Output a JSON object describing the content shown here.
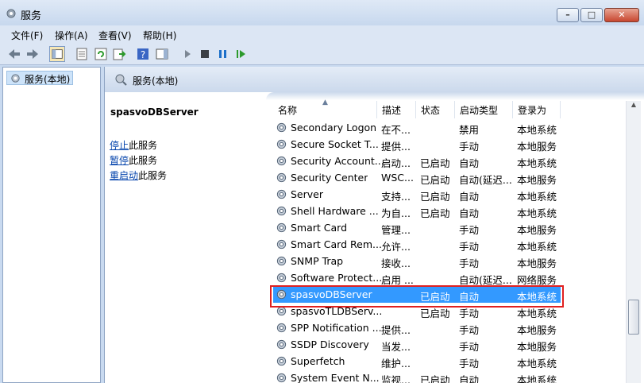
{
  "window": {
    "title": "服务"
  },
  "menu": [
    "文件(F)",
    "操作(A)",
    "查看(V)",
    "帮助(H)"
  ],
  "tree": {
    "root_label": "服务(本地)"
  },
  "content": {
    "header_label": "服务(本地)",
    "service_title": "spasvoDBServer",
    "actions": [
      {
        "link": "停止",
        "suffix": "此服务"
      },
      {
        "link": "暂停",
        "suffix": "此服务"
      },
      {
        "link": "重启动",
        "suffix": "此服务"
      }
    ]
  },
  "columns": [
    "名称",
    "描述",
    "状态",
    "启动类型",
    "登录为"
  ],
  "services": [
    {
      "name": "Secondary Logon",
      "desc": "在不...",
      "status": "",
      "startup": "禁用",
      "logon": "本地系统"
    },
    {
      "name": "Secure Socket T...",
      "desc": "提供...",
      "status": "",
      "startup": "手动",
      "logon": "本地服务"
    },
    {
      "name": "Security Account...",
      "desc": "启动...",
      "status": "已启动",
      "startup": "自动",
      "logon": "本地系统"
    },
    {
      "name": "Security Center",
      "desc": "WSC...",
      "status": "已启动",
      "startup": "自动(延迟...",
      "logon": "本地服务"
    },
    {
      "name": "Server",
      "desc": "支持...",
      "status": "已启动",
      "startup": "自动",
      "logon": "本地系统"
    },
    {
      "name": "Shell Hardware ...",
      "desc": "为自...",
      "status": "已启动",
      "startup": "自动",
      "logon": "本地系统"
    },
    {
      "name": "Smart Card",
      "desc": "管理...",
      "status": "",
      "startup": "手动",
      "logon": "本地服务"
    },
    {
      "name": "Smart Card Rem...",
      "desc": "允许...",
      "status": "",
      "startup": "手动",
      "logon": "本地系统"
    },
    {
      "name": "SNMP Trap",
      "desc": "接收...",
      "status": "",
      "startup": "手动",
      "logon": "本地服务"
    },
    {
      "name": "Software Protect...",
      "desc": "启用 ...",
      "status": "",
      "startup": "自动(延迟...",
      "logon": "网络服务"
    },
    {
      "name": "spasvoDBServer",
      "desc": "",
      "status": "已启动",
      "startup": "自动",
      "logon": "本地系统"
    },
    {
      "name": "spasvoTLDBServ...",
      "desc": "",
      "status": "已启动",
      "startup": "手动",
      "logon": "本地系统"
    },
    {
      "name": "SPP Notification ...",
      "desc": "提供...",
      "status": "",
      "startup": "手动",
      "logon": "本地服务"
    },
    {
      "name": "SSDP Discovery",
      "desc": "当发...",
      "status": "",
      "startup": "手动",
      "logon": "本地服务"
    },
    {
      "name": "Superfetch",
      "desc": "维护...",
      "status": "",
      "startup": "手动",
      "logon": "本地系统"
    },
    {
      "name": "System Event N...",
      "desc": "监视...",
      "status": "已启动",
      "startup": "自动",
      "logon": "本地系统"
    }
  ],
  "selected_service": "spasvoDBServer"
}
